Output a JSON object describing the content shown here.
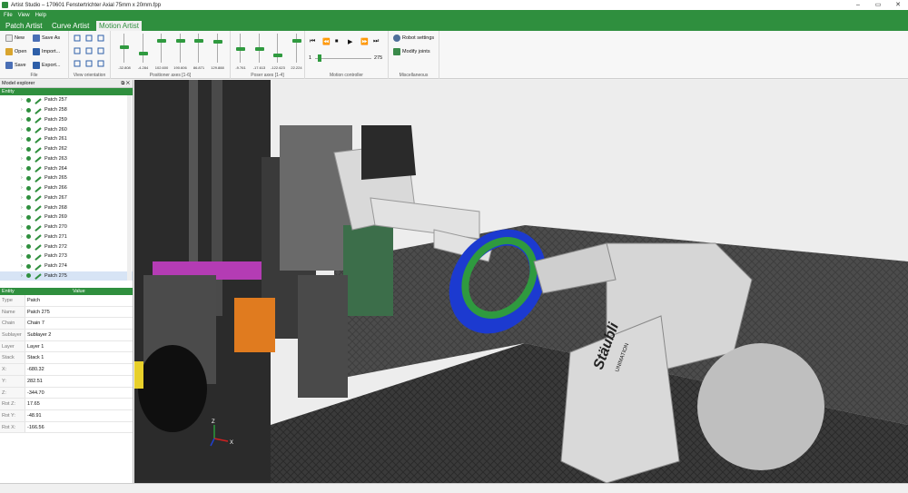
{
  "window": {
    "title": "Artist Studio – 170601 Fenstertrichter Axial 75mm x 20mm.fpp"
  },
  "menu": [
    "File",
    "View",
    "Help"
  ],
  "tabs": [
    {
      "label": "Patch Artist",
      "active": false
    },
    {
      "label": "Curve Artist",
      "active": false
    },
    {
      "label": "Motion Artist",
      "active": true
    }
  ],
  "ribbon": {
    "file": {
      "label": "File",
      "new": "New",
      "save_as": "Save As",
      "open": "Open",
      "import": "Import...",
      "save": "Save",
      "export": "Export..."
    },
    "view_orientation": {
      "label": "View orientation"
    },
    "positioner_axes": {
      "label": "Positioner axes [1-6]",
      "values": [
        "-32.808",
        "-4.284",
        "102.600",
        "190.606",
        "86.871",
        "129.888"
      ],
      "levels": [
        0.55,
        0.3,
        0.8,
        0.8,
        0.8,
        0.75
      ]
    },
    "poser_axes": {
      "label": "Poser axes [1-4]",
      "values": [
        "-9.761",
        "-17.613",
        "-122.623",
        "22.224"
      ],
      "levels": [
        0.45,
        0.45,
        0.2,
        0.8
      ]
    },
    "motion_controller": {
      "label": "Motion controller",
      "start": "1",
      "end": "275",
      "position": 0.05
    },
    "misc": {
      "label": "Miscellaneous",
      "robot_settings": "Robot settings",
      "modify_joints": "Modify joints"
    }
  },
  "model_explorer": {
    "title": "Model explorer",
    "column": "Entity",
    "patches": [
      "Patch 257",
      "Patch 258",
      "Patch 259",
      "Patch 260",
      "Patch 261",
      "Patch 262",
      "Patch 263",
      "Patch 264",
      "Patch 265",
      "Patch 266",
      "Patch 267",
      "Patch 268",
      "Patch 269",
      "Patch 270",
      "Patch 271",
      "Patch 272",
      "Patch 273",
      "Patch 274",
      "Patch 275"
    ],
    "selected": "Patch 275"
  },
  "properties": {
    "col_entity": "Entity",
    "col_value": "Value",
    "rows": [
      {
        "k": "Type",
        "v": "Patch"
      },
      {
        "k": "Name",
        "v": "Patch 275"
      },
      {
        "k": "Chain",
        "v": "Chain 7"
      },
      {
        "k": "Sublayer",
        "v": "Sublayer 2"
      },
      {
        "k": "Layer",
        "v": "Layer 1"
      },
      {
        "k": "Stack",
        "v": "Stack 1"
      },
      {
        "k": "X:",
        "v": "-680.32"
      },
      {
        "k": "Y:",
        "v": "282.51"
      },
      {
        "k": "Z:",
        "v": "-344.70"
      },
      {
        "k": "Rot Z:",
        "v": "17.65"
      },
      {
        "k": "Rot Y:",
        "v": "-48.91"
      },
      {
        "k": "Rot X:",
        "v": "-166.56"
      }
    ]
  },
  "viewport": {
    "axes": {
      "z": "Z",
      "x": "X"
    },
    "robot_brand": "Stäubli",
    "robot_model": "UNIMATION"
  }
}
